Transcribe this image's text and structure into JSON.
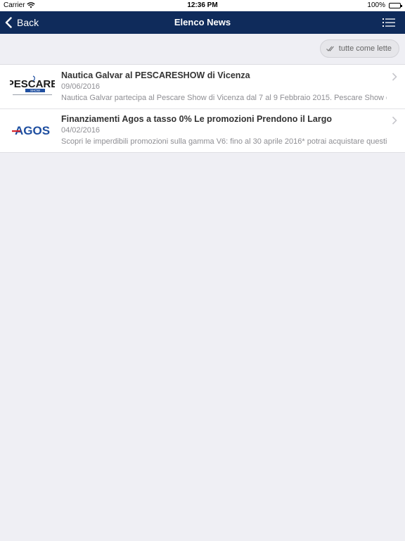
{
  "status_bar": {
    "carrier": "Carrier",
    "time": "12:36 PM",
    "battery": "100%"
  },
  "navbar": {
    "back_label": "Back",
    "title": "Elenco News",
    "menu_icon": "list-icon"
  },
  "toolbar": {
    "mark_all_label": "tutte come lette",
    "mark_all_icon": "double-check-icon"
  },
  "news": [
    {
      "title": "Nautica Galvar al PESCARESHOW di Vicenza",
      "date": "09/06/2016",
      "snippet": "Nautica Galvar partecipa al Pescare Show di Vicenza dal 7 al 9 Febbraio 2015. Pescare Show è il",
      "logo_text_main": "PESCARE",
      "logo_text_sub": "SHOW"
    },
    {
      "title": "Finanziamenti Agos a tasso 0% Le promozioni Prendono il Largo",
      "date": "04/02/2016",
      "snippet": "Scopri le imperdibili promozioni sulla gamma V6: fino al 30 aprile 2016* potrai acquistare questi",
      "logo_text_main": "AGOS"
    }
  ],
  "colors": {
    "navbar": "#0f2b5b",
    "background": "#efeff4",
    "agos_blue": "#1f4fa0",
    "agos_red": "#d7262b"
  }
}
